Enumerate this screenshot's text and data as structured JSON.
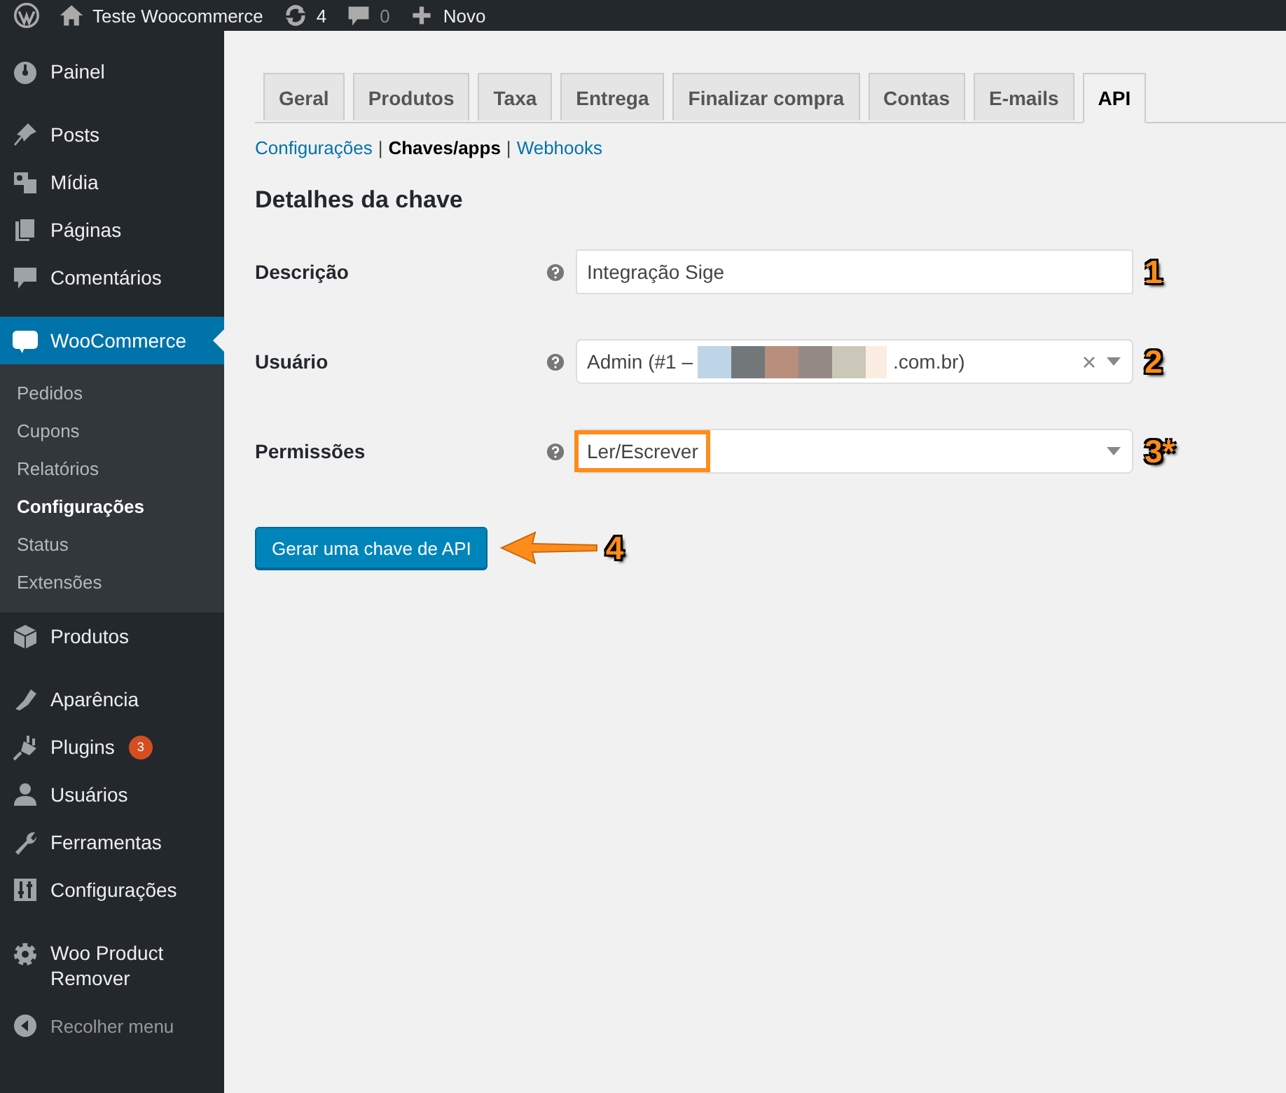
{
  "admin_bar": {
    "site_name": "Teste Woocommerce",
    "updates_count": "4",
    "comments_count": "0",
    "new_label": "Novo"
  },
  "sidebar": {
    "sections": [
      {
        "items": [
          {
            "label": "Painel",
            "selected": false
          }
        ]
      },
      {
        "items": [
          {
            "label": "Posts",
            "selected": false
          },
          {
            "label": "Mídia",
            "selected": false
          },
          {
            "label": "Páginas",
            "selected": false
          },
          {
            "label": "Comentários",
            "selected": false
          }
        ]
      },
      {
        "items": [
          {
            "label": "WooCommerce",
            "selected": true,
            "children": [
              {
                "label": "Pedidos",
                "selected": false
              },
              {
                "label": "Cupons",
                "selected": false
              },
              {
                "label": "Relatórios",
                "selected": false
              },
              {
                "label": "Configurações",
                "selected": true
              },
              {
                "label": "Status",
                "selected": false
              },
              {
                "label": "Extensões",
                "selected": false
              }
            ]
          },
          {
            "label": "Produtos",
            "selected": false
          }
        ]
      },
      {
        "items": [
          {
            "label": "Aparência",
            "selected": false
          },
          {
            "label": "Plugins",
            "selected": false,
            "badge": "3"
          },
          {
            "label": "Usuários",
            "selected": false
          },
          {
            "label": "Ferramentas",
            "selected": false
          },
          {
            "label": "Configurações",
            "selected": false
          }
        ]
      },
      {
        "items": [
          {
            "label": "Woo Product Remover",
            "selected": false
          },
          {
            "label": "Recolher menu",
            "selected": false,
            "kind": "collapse"
          }
        ]
      }
    ]
  },
  "tabs": [
    {
      "label": "Geral",
      "selected": false
    },
    {
      "label": "Produtos",
      "selected": false
    },
    {
      "label": "Taxa",
      "selected": false
    },
    {
      "label": "Entrega",
      "selected": false
    },
    {
      "label": "Finalizar compra",
      "selected": false
    },
    {
      "label": "Contas",
      "selected": false
    },
    {
      "label": "E-mails",
      "selected": false
    },
    {
      "label": "API",
      "selected": true
    }
  ],
  "subnav": {
    "separator": "|",
    "items": [
      {
        "label": "Configurações",
        "selected": false
      },
      {
        "label": "Chaves/apps",
        "selected": true
      },
      {
        "label": "Webhooks",
        "selected": false
      }
    ]
  },
  "heading": "Detalhes da chave",
  "fields": [
    {
      "kind": "text",
      "label": "Descrição",
      "value": "Integração Sige",
      "marker": "1"
    },
    {
      "kind": "select",
      "label": "Usuário",
      "value": "Admin (#1 –",
      "value_end": ".com.br)",
      "clearable": true,
      "highlighted": false,
      "marker": "2"
    },
    {
      "kind": "select",
      "label": "Permissões",
      "value": "Ler/Escrever",
      "clearable": false,
      "highlighted": true,
      "marker": "3*"
    }
  ],
  "submit": {
    "label": "Gerar uma chave de API",
    "marker": "4"
  }
}
